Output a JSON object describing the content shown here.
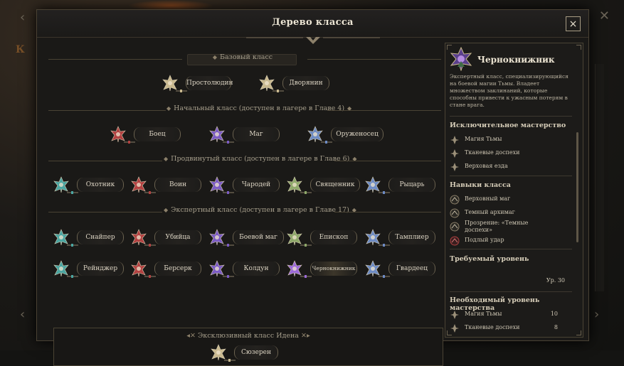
{
  "window": {
    "title": "Дерево класса",
    "close_icon": "×"
  },
  "background": {
    "partial_text": "К"
  },
  "tree": {
    "base": {
      "label": "Базовый класс",
      "nodes": [
        {
          "name": "Простолюдин",
          "icon": "commoner-icon",
          "color": "#c9b98f"
        },
        {
          "name": "Дворянин",
          "icon": "noble-icon",
          "color": "#c9b98f"
        }
      ]
    },
    "starting": {
      "label": "Начальный класс (доступен в лагере в Главе 4)",
      "nodes": [
        {
          "name": "Боец",
          "icon": "fighter-icon",
          "color": "#b24141"
        },
        {
          "name": "Маг",
          "icon": "mage-icon",
          "color": "#7b5bc4"
        },
        {
          "name": "Оруженосец",
          "icon": "squire-icon",
          "color": "#6d8bc4"
        }
      ]
    },
    "advanced": {
      "label": "Продвинутый класс (доступен в лагере в Главе 6)",
      "nodes": [
        {
          "name": "Охотник",
          "icon": "hunter-icon",
          "color": "#4aa5a1"
        },
        {
          "name": "Воин",
          "icon": "warrior-icon",
          "color": "#b24141"
        },
        {
          "name": "Чародей",
          "icon": "sorcerer-icon",
          "color": "#7b5bc4"
        },
        {
          "name": "Священник",
          "icon": "priest-icon",
          "color": "#8ea86a"
        },
        {
          "name": "Рыцарь",
          "icon": "knight-icon",
          "color": "#6d8bc4"
        }
      ]
    },
    "expert": {
      "label": "Экспертный класс (доступен в лагере в Главе 17)",
      "row1": [
        {
          "name": "Снайпер",
          "icon": "sniper-icon",
          "color": "#4aa5a1"
        },
        {
          "name": "Убийца",
          "icon": "assassin-icon",
          "color": "#b24141"
        },
        {
          "name": "Боевой маг",
          "icon": "battlemage-icon",
          "color": "#7b5bc4"
        },
        {
          "name": "Епископ",
          "icon": "bishop-icon",
          "color": "#8ea86a"
        },
        {
          "name": "Тамплиер",
          "icon": "templar-icon",
          "color": "#6d8bc4"
        }
      ],
      "row2": [
        {
          "name": "Рейнджер",
          "icon": "ranger-icon",
          "color": "#4aa5a1"
        },
        {
          "name": "Берсерк",
          "icon": "berserker-icon",
          "color": "#b24141"
        },
        {
          "name": "Колдун",
          "icon": "warlock-icon",
          "color": "#7b5bc4"
        },
        {
          "name": "Чернокнижник",
          "icon": "necromancer-icon",
          "color": "#9b6ad8",
          "selected": true
        },
        {
          "name": "Гвардеец",
          "icon": "guardian-icon",
          "color": "#6d8bc4"
        }
      ]
    },
    "exclusive": {
      "label": "Эксклюзивный класс Идена",
      "node": {
        "name": "Сюзерен",
        "icon": "sovereign-icon",
        "color": "#c9b98f"
      }
    }
  },
  "panel": {
    "class_name": "Чернокнижник",
    "class_icon": "necromancer-emblem-icon",
    "description": "Экспертный класс, специализирующийся на боевой магии Тьмы. Владеет множеством заклинаний, которые способны привести к ужасным потерям в стане врага.",
    "exclusive_mastery": {
      "title": "Исключительное мастерство",
      "items": [
        "Магия Тьмы",
        "Тканевые доспехи",
        "Верховая езда"
      ]
    },
    "class_skills": {
      "title": "Навыки класса",
      "items": [
        "Верховный маг",
        "Темный архимаг",
        "Прозрение: «Темные доспехи»",
        "Подлый удар"
      ]
    },
    "required_level": {
      "title": "Требуемый уровень",
      "value": "Ур. 30"
    },
    "required_mastery": {
      "title": "Необходимый уровень мастерства",
      "items": [
        {
          "label": "Магия Тьмы",
          "value": "10"
        },
        {
          "label": "Тканевые доспехи",
          "value": "8"
        }
      ]
    }
  },
  "colors": {
    "accent_gold": "#a79f8c",
    "frame": "#4a4334",
    "panel_bg": "#1c1b19"
  }
}
